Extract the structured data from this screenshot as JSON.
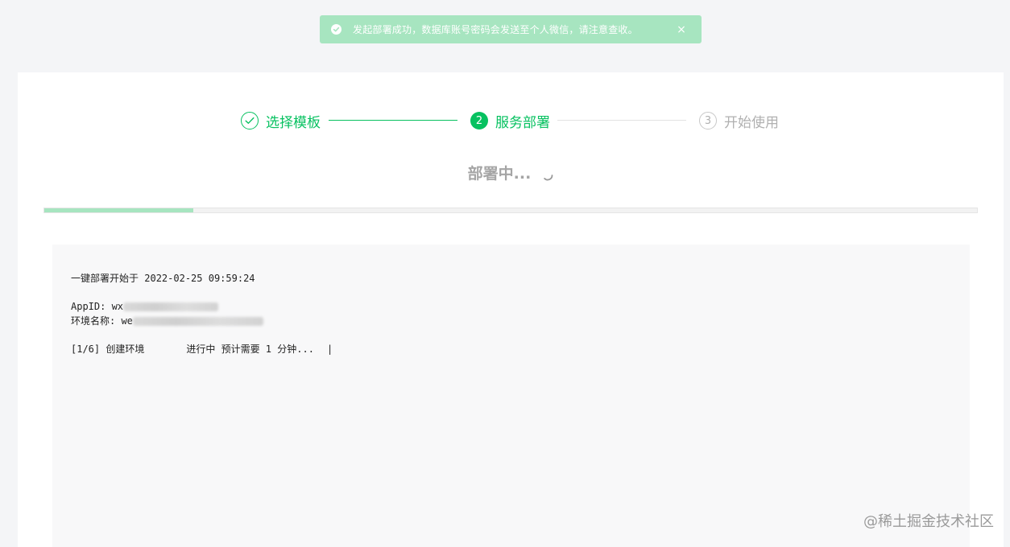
{
  "toast": {
    "message": "发起部署成功，数据库账号密码会发送至个人微信，请注意查收。",
    "close_glyph": "×",
    "icon": "check-circle-icon"
  },
  "steps": [
    {
      "number": "",
      "label": "选择模板",
      "state": "done",
      "icon": "check-icon"
    },
    {
      "number": "2",
      "label": "服务部署",
      "state": "active"
    },
    {
      "number": "3",
      "label": "开始使用",
      "state": "todo"
    }
  ],
  "status": {
    "text": "部署中...",
    "icon": "spinner-icon"
  },
  "progress": {
    "value_percent": 16
  },
  "log": {
    "start_prefix": "一键部署开始于",
    "start_time": "2022-02-25 09:59:24",
    "appid_label": "AppID: wx",
    "env_label": "环境名称: we",
    "step_prefix": "[1/6] 创建环境",
    "step_status": "进行中 预计需要 1 分钟...",
    "step_separator": "|"
  },
  "watermark": "@稀土掘金技术社区",
  "colors": {
    "accent": "#07c160",
    "toast_bg": "#a7e5c0",
    "muted": "#b0b0b0"
  }
}
